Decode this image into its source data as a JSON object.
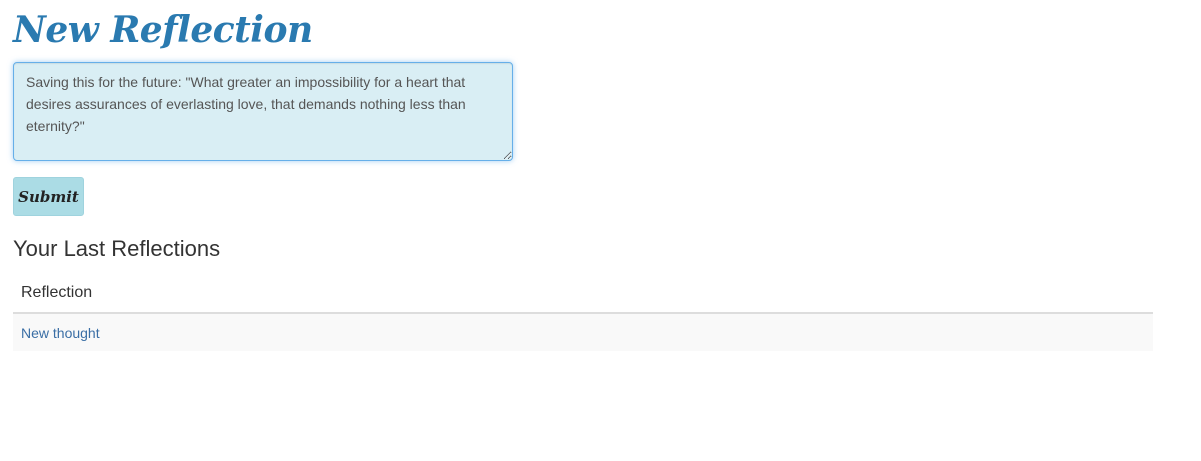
{
  "header": {
    "title": "New Reflection"
  },
  "form": {
    "reflection_text": "Saving this for the future: \"What greater an impossibility for a heart that desires assurances of everlasting love, that demands nothing less than eternity?\"",
    "submit_label": "Submit"
  },
  "reflections": {
    "section_title": "Your Last Reflections",
    "columns": [
      "Reflection"
    ],
    "rows": [
      {
        "title": "New thought"
      }
    ]
  },
  "colors": {
    "title": "#2a7ab0",
    "textarea_bg": "#d9eef4",
    "textarea_border": "#66afe9",
    "button_bg": "#abdce5",
    "link": "#3a6ea5",
    "row_bg": "#f9f9f9"
  }
}
